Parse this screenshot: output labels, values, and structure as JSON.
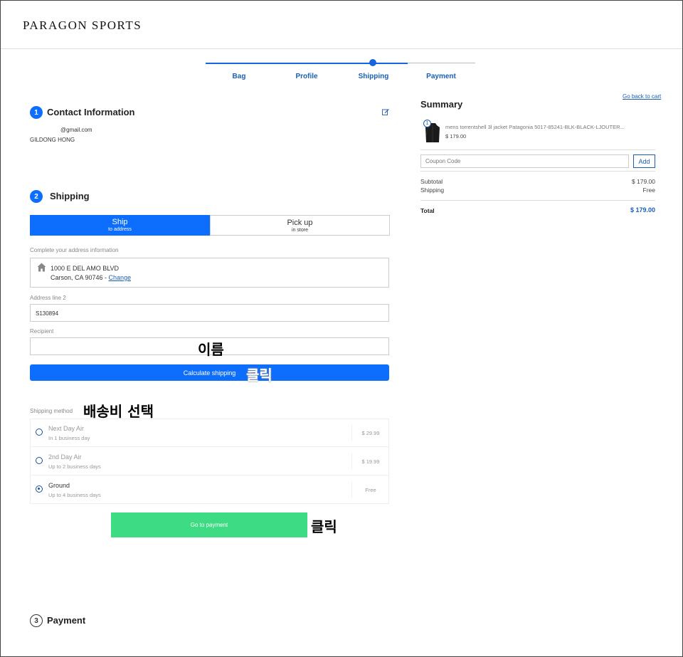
{
  "brand": {
    "logo_text": "PARAGON SPORTS"
  },
  "progress": {
    "steps": [
      "Bag",
      "Profile",
      "Shipping",
      "Payment"
    ],
    "current": "Shipping",
    "accent": "#1565e0"
  },
  "contact": {
    "number": "1",
    "title": "Contact Information",
    "email": "@gmail.com",
    "name": "GILDONG HONG"
  },
  "shipping": {
    "number": "2",
    "title": "Shipping",
    "tabs": [
      {
        "main": "Ship",
        "sub": "to address",
        "active": true
      },
      {
        "main": "Pick up",
        "sub": "in store",
        "active": false
      }
    ],
    "address_label": "Complete your address information",
    "address_line1": "1000 E DEL AMO BLVD",
    "address_line2": "Carson, CA 90746 - ",
    "change_link": "Change",
    "address2_label": "Address line 2",
    "address2_value": "S130894",
    "recipient_label": "Recipient",
    "recipient_annotation": "이름",
    "calculate_button": "Calculate shipping",
    "calculate_annotation": "클릭",
    "method_label": "Shipping method",
    "method_annotation": "배송비 선택",
    "methods": [
      {
        "name": "Next Day Air",
        "sub": "In 1 business day",
        "price": "$ 29.99",
        "selected": false
      },
      {
        "name": "2nd Day Air",
        "sub": "Up to 2 business days",
        "price": "$ 19.99",
        "selected": false
      },
      {
        "name": "Ground",
        "sub": "Up to 4 business days",
        "price": "Free",
        "selected": true
      }
    ],
    "payment_button": "Go to payment",
    "payment_annotation": "클릭"
  },
  "payment": {
    "number": "3",
    "title": "Payment"
  },
  "summary": {
    "title": "Summary",
    "back_link": "Go back to cart",
    "item_qty": "1",
    "item_name": "mens torrentshell 3l jacket Patagonia 5017-85241-BLK-BLACK-LJOUTER...",
    "item_price": "$ 179.00",
    "coupon_placeholder": "Coupon Code",
    "coupon_button": "Add",
    "subtotal_label": "Subtotal",
    "subtotal_value": "$ 179.00",
    "shipping_label": "Shipping",
    "shipping_value": "Free",
    "total_label": "Total",
    "total_value": "$ 179.00"
  }
}
